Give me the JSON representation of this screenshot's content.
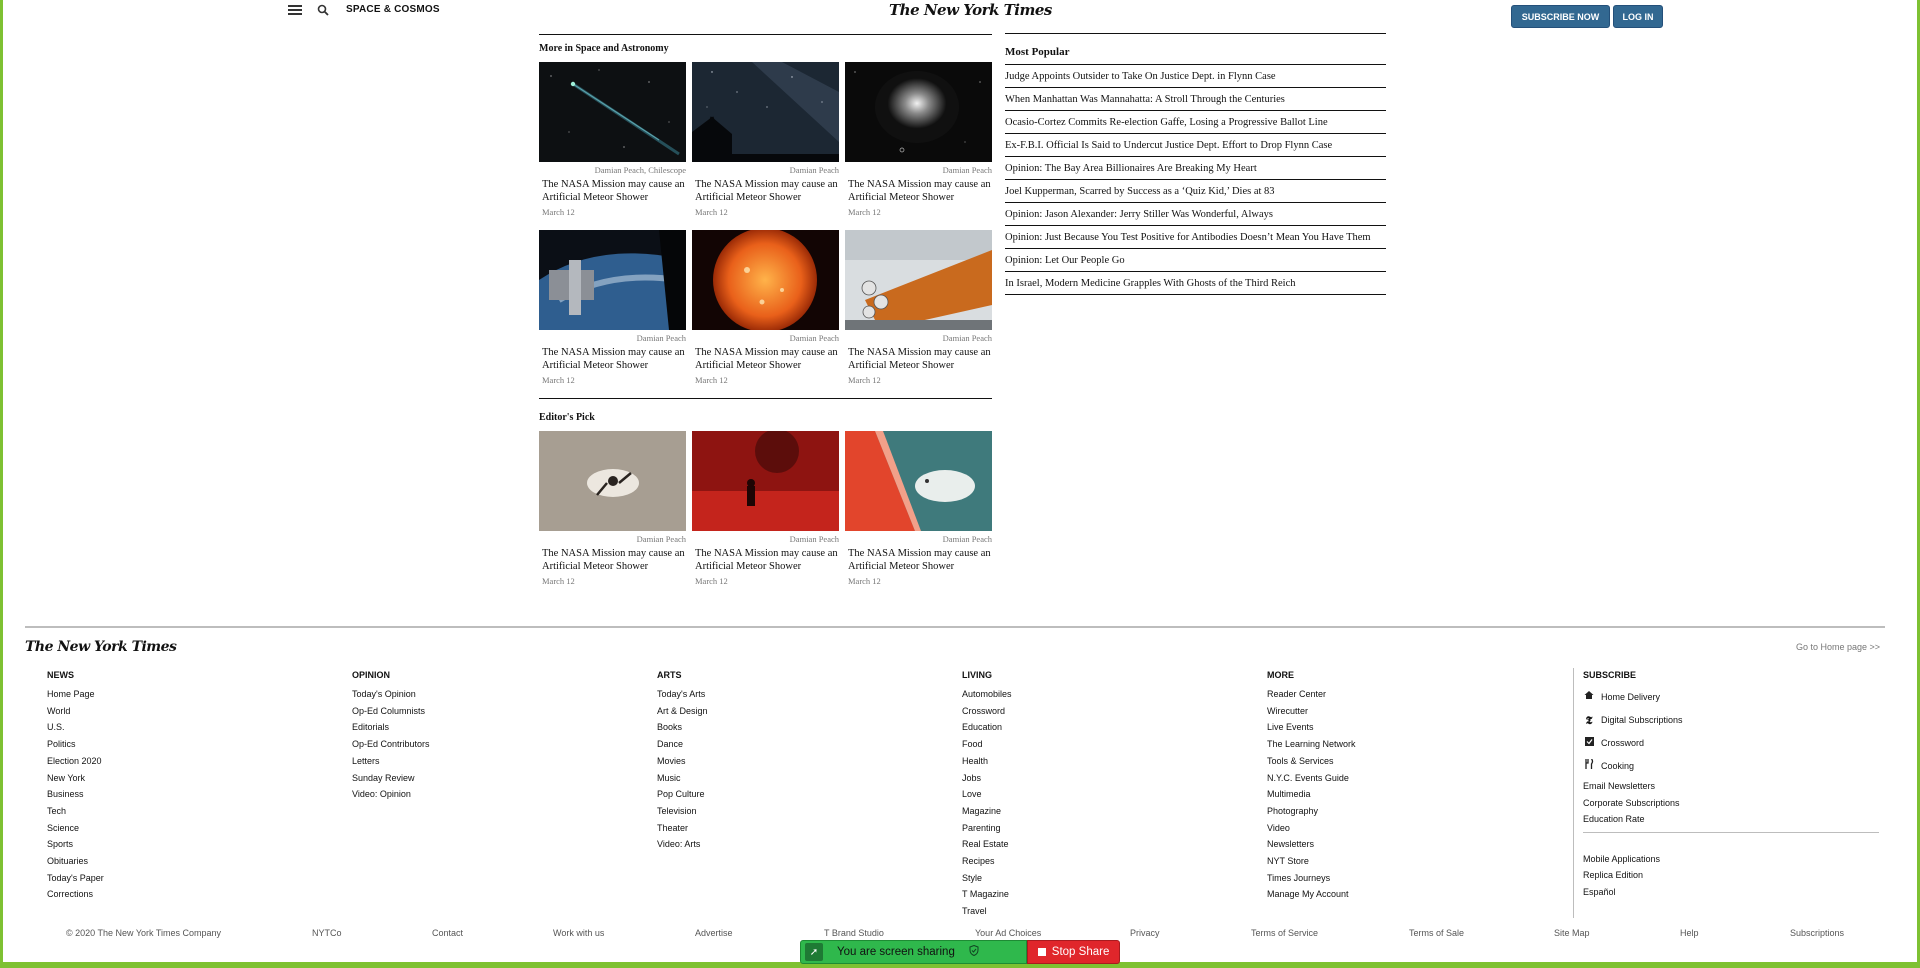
{
  "header": {
    "section": "SPACE & COSMOS",
    "logo": "The New York Times",
    "subscribe_label": "SUBSCRIBE NOW",
    "login_label": "LOG IN"
  },
  "more_section": {
    "heading": "More in Space and Astronomy",
    "cards": [
      {
        "credit": "Damian Peach, Chilescope",
        "title": "The NASA Mission may cause an Artificial Meteor Shower",
        "date": "March 12"
      },
      {
        "credit": "Damian Peach",
        "title": "The NASA Mission may cause an Artificial Meteor Shower",
        "date": "March 12"
      },
      {
        "credit": "Damian Peach",
        "title": "The NASA Mission may cause an Artificial Meteor Shower",
        "date": "March 12"
      },
      {
        "credit": "Damian Peach",
        "title": "The NASA Mission may cause an Artificial Meteor Shower",
        "date": "March 12"
      },
      {
        "credit": "Damian Peach",
        "title": "The NASA Mission may cause an Artificial Meteor Shower",
        "date": "March 12"
      },
      {
        "credit": "Damian Peach",
        "title": "The NASA Mission may cause an Artificial Meteor Shower",
        "date": "March 12"
      }
    ]
  },
  "editors_pick": {
    "heading": "Editor's Pick",
    "cards": [
      {
        "credit": "Damian Peach",
        "title": "The NASA Mission may cause an Artificial Meteor Shower",
        "date": "March 12"
      },
      {
        "credit": "Damian Peach",
        "title": "The NASA Mission may cause an Artificial Meteor Shower",
        "date": "March 12"
      },
      {
        "credit": "Damian Peach",
        "title": "The NASA Mission may cause an Artificial Meteor Shower",
        "date": "March 12"
      }
    ]
  },
  "most_popular": {
    "heading": "Most Popular",
    "items": [
      "Judge Appoints Outsider to Take On Justice Dept. in Flynn Case",
      "When Manhattan Was Mannahatta: A Stroll Through the Centuries",
      "Ocasio-Cortez Commits Re-election Gaffe, Losing a Progressive Ballot Line",
      "Ex-F.B.I. Official Is Said to Undercut Justice Dept. Effort to Drop Flynn Case",
      "Opinion: The Bay Area Billionaires Are Breaking My Heart",
      "Joel Kupperman, Scarred by Success as a ‘Quiz Kid,’ Dies at 83",
      "Opinion: Jason Alexander: Jerry Stiller Was Wonderful, Always",
      "Opinion: Just Because You Test Positive for Antibodies Doesn’t Mean You Have Them",
      "Opinion: Let Our People Go",
      "In Israel, Modern Medicine Grapples With Ghosts of the Third Reich"
    ]
  },
  "footer": {
    "logo": "The New York Times",
    "home_link": "Go to Home page >>",
    "columns": [
      {
        "title": "NEWS",
        "links": [
          "Home Page",
          "World",
          "U.S.",
          "Politics",
          "Election 2020",
          "New York",
          "Business",
          "Tech",
          "Science",
          "Sports",
          "Obituaries",
          "Today's Paper",
          "Corrections"
        ]
      },
      {
        "title": "OPINION",
        "links": [
          "Today's Opinion",
          "Op-Ed Columnists",
          "Editorials",
          "Op-Ed Contributors",
          "Letters",
          "Sunday Review",
          "Video: Opinion"
        ]
      },
      {
        "title": "ARTS",
        "links": [
          "Today's Arts",
          "Art & Design",
          "Books",
          "Dance",
          "Movies",
          "Music",
          "Pop Culture",
          "Television",
          "Theater",
          "Video: Arts"
        ]
      },
      {
        "title": "LIVING",
        "links": [
          "Automobiles",
          "Crossword",
          "Education",
          "Food",
          "Health",
          "Jobs",
          "Love",
          "Magazine",
          "Parenting",
          "Real Estate",
          "Recipes",
          "Style",
          "T Magazine",
          "Travel"
        ]
      },
      {
        "title": "MORE",
        "links": [
          "Reader Center",
          "Wirecutter",
          "Live Events",
          "The Learning Network",
          "Tools & Services",
          "N.Y.C. Events Guide",
          "Multimedia",
          "Photography",
          "Video",
          "Newsletters",
          "NYT Store",
          "Times Journeys",
          "Manage My Account"
        ]
      }
    ],
    "subscribe": {
      "title": "SUBSCRIBE",
      "icon_links": [
        {
          "icon": "home-icon",
          "label": "Home Delivery"
        },
        {
          "icon": "nyt-t-icon",
          "label": "Digital Subscriptions"
        },
        {
          "icon": "crossword-icon",
          "label": "Crossword"
        },
        {
          "icon": "cooking-icon",
          "label": "Cooking"
        }
      ],
      "links": [
        "Email Newsletters",
        "Corporate Subscriptions",
        "Education Rate"
      ],
      "more_links": [
        "Mobile Applications",
        "Replica Edition",
        "Español"
      ]
    },
    "bottom": [
      "© 2020 The New York Times Company",
      "NYTCo",
      "Contact",
      "Work with us",
      "Advertise",
      "T Brand Studio",
      "Your Ad Choices",
      "Privacy",
      "Terms of Service",
      "Terms of Sale",
      "Site Map",
      "Help",
      "Subscriptions"
    ]
  },
  "screen_share": {
    "status": "You are screen sharing",
    "stop_label": "Stop Share"
  },
  "colors": {
    "accent": "#326891",
    "share_green": "#2fb84c",
    "share_red": "#e0262b",
    "frame_green": "#7ec132"
  }
}
